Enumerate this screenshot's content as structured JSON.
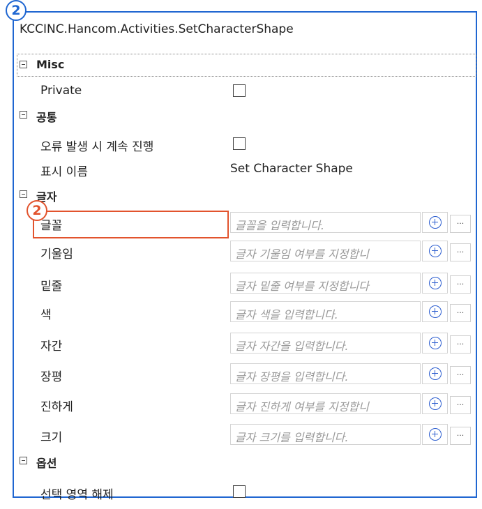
{
  "title": "KCCINC.Hancom.Activities.SetCharacterShape",
  "callout": "2",
  "categories": {
    "misc": "Misc",
    "common": "공통",
    "char": "글자",
    "options": "옵션"
  },
  "misc": {
    "private_label": "Private",
    "private_checked": false
  },
  "common": {
    "continue_on_error_label": "오류 발생 시 계속 진행",
    "continue_on_error_checked": false,
    "display_name_label": "표시 이름",
    "display_name_value": "Set Character Shape"
  },
  "char": {
    "font": {
      "label": "글꼴",
      "placeholder": "글꼴을 입력합니다."
    },
    "italic": {
      "label": "기울임",
      "placeholder": "글자 기울임 여부를 지정합니"
    },
    "underline": {
      "label": "밑줄",
      "placeholder": "글자 밑줄 여부를 지정합니다"
    },
    "color": {
      "label": "색",
      "placeholder": "글자 색을 입력합니다."
    },
    "spacing": {
      "label": "자간",
      "placeholder": "글자 자간을 입력합니다."
    },
    "ratio": {
      "label": "장평",
      "placeholder": "글자 장평을 입력합니다."
    },
    "bold": {
      "label": "진하게",
      "placeholder": "글자 진하게 여부를 지정합니"
    },
    "size": {
      "label": "크기",
      "placeholder": "글자 크기를 입력합니다."
    },
    "add_icon": "plus-circle-icon",
    "more_label": "..."
  },
  "options": {
    "deselect_label": "선택 영역 해제",
    "deselect_checked": false
  },
  "colors": {
    "frame": "#1f66d1",
    "highlight": "#e2532d",
    "add_icon": "#2a5ccf"
  }
}
